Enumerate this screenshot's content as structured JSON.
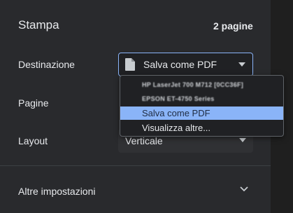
{
  "header": {
    "title": "Stampa",
    "page_count": "2 pagine"
  },
  "destination": {
    "label": "Destinazione",
    "value": "Salva come PDF",
    "icon": "document-icon",
    "options": [
      {
        "label": "HP LaserJet 700 M712 [0CC36F]",
        "selected": false
      },
      {
        "label": "EPSON ET-4750 Series",
        "selected": false
      },
      {
        "label": "Salva come PDF",
        "selected": true
      },
      {
        "label": "Visualizza altre...",
        "selected": false
      }
    ]
  },
  "pages": {
    "label": "Pagine"
  },
  "layout": {
    "label": "Layout",
    "value": "Verticale"
  },
  "advanced": {
    "label": "Altre impostazioni",
    "icon": "chevron-down-icon"
  },
  "colors": {
    "accent": "#8ab4f8",
    "panel_bg": "#292a2d"
  }
}
